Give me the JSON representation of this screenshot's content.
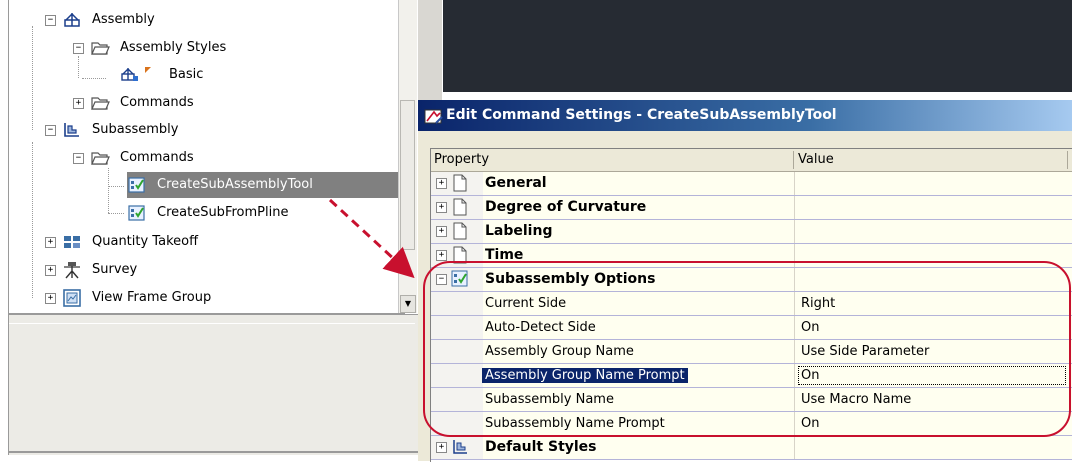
{
  "tree": {
    "items": [
      {
        "label": "Assembly",
        "expander": "−",
        "icon": "assembly-icon"
      },
      {
        "label": "Assembly Styles",
        "expander": "−",
        "icon": "folder-open-icon"
      },
      {
        "label": "Basic",
        "expander": "",
        "icon": "assembly-style-icon"
      },
      {
        "label": "Commands",
        "expander": "+",
        "icon": "folder-open-icon"
      },
      {
        "label": "Subassembly",
        "expander": "−",
        "icon": "subassembly-icon"
      },
      {
        "label": "Commands",
        "expander": "−",
        "icon": "folder-open-icon"
      },
      {
        "label": "CreateSubAssemblyTool",
        "expander": "",
        "icon": "command-check-icon",
        "selected": true
      },
      {
        "label": "CreateSubFromPline",
        "expander": "",
        "icon": "command-check-icon"
      },
      {
        "label": "Quantity Takeoff",
        "expander": "+",
        "icon": "quantity-takeoff-icon"
      },
      {
        "label": "Survey",
        "expander": "+",
        "icon": "survey-icon"
      },
      {
        "label": "View Frame Group",
        "expander": "+",
        "icon": "view-frame-icon"
      }
    ]
  },
  "dialog": {
    "title": "Edit Command Settings - CreateSubAssemblyTool",
    "columns": {
      "property": "Property",
      "value": "Value"
    },
    "rows": [
      {
        "type": "category",
        "label": "General",
        "expander": "+",
        "icon": "page-icon"
      },
      {
        "type": "category",
        "label": "Degree of Curvature",
        "expander": "+",
        "icon": "page-icon"
      },
      {
        "type": "category",
        "label": "Labeling",
        "expander": "+",
        "icon": "page-icon"
      },
      {
        "type": "category",
        "label": "Time",
        "expander": "+",
        "icon": "page-icon"
      },
      {
        "type": "category",
        "label": "Subassembly Options",
        "expander": "−",
        "icon": "command-check-icon"
      },
      {
        "type": "property",
        "label": "Current Side",
        "value": "Right"
      },
      {
        "type": "property",
        "label": "Auto-Detect Side",
        "value": "On"
      },
      {
        "type": "property",
        "label": "Assembly Group Name",
        "value": "Use Side Parameter"
      },
      {
        "type": "property",
        "label": "Assembly Group Name Prompt",
        "value": "On",
        "selected": true
      },
      {
        "type": "property",
        "label": "Subassembly Name",
        "value": "Use Macro Name"
      },
      {
        "type": "property",
        "label": "Subassembly Name Prompt",
        "value": "On"
      },
      {
        "type": "category",
        "label": "Default Styles",
        "expander": "+",
        "icon": "styles-icon"
      }
    ]
  },
  "colors": {
    "selection": "#0a246a",
    "tree_selection": "#808080",
    "annotation": "#c8102e",
    "titlebar": "#0a246a"
  }
}
